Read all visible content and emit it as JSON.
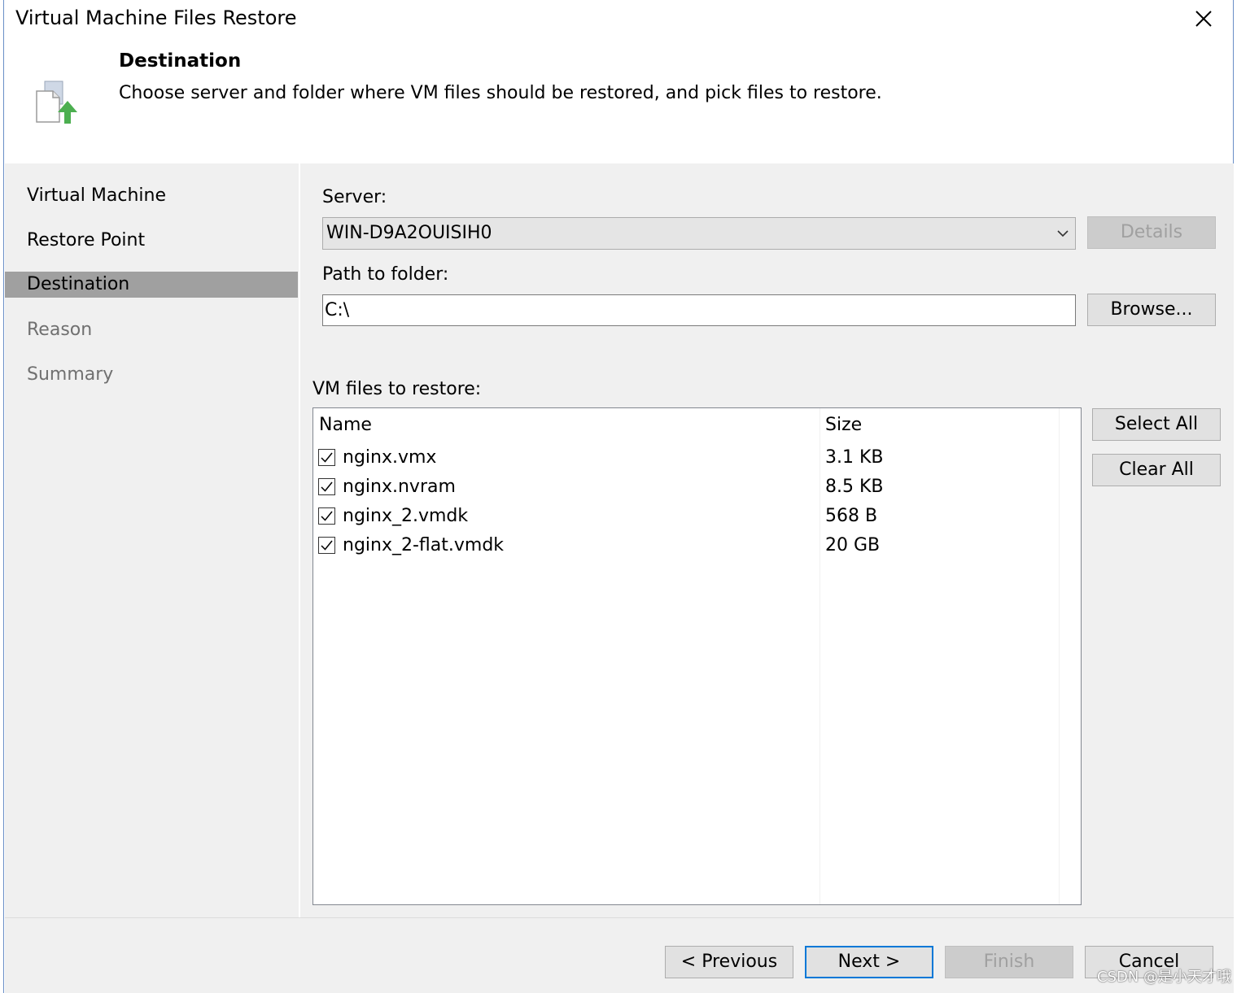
{
  "window": {
    "title": "Virtual Machine Files Restore"
  },
  "header": {
    "heading": "Destination",
    "description": "Choose server and folder where VM files should be restored, and pick files to restore."
  },
  "nav": {
    "items": [
      {
        "label": "Virtual Machine",
        "state": "normal"
      },
      {
        "label": "Restore Point",
        "state": "normal"
      },
      {
        "label": "Destination",
        "state": "active"
      },
      {
        "label": "Reason",
        "state": "disabled"
      },
      {
        "label": "Summary",
        "state": "disabled"
      }
    ]
  },
  "server": {
    "label": "Server:",
    "value": "WIN-D9A2OUISIH0",
    "details_label": "Details"
  },
  "path": {
    "label": "Path to folder:",
    "value": "C:\\",
    "browse_label": "Browse..."
  },
  "files": {
    "label": "VM files to restore:",
    "columns": [
      "Name",
      "Size"
    ],
    "rows": [
      {
        "name": "nginx.vmx",
        "size": "3.1 KB",
        "checked": true
      },
      {
        "name": "nginx.nvram",
        "size": "8.5 KB",
        "checked": true
      },
      {
        "name": "nginx_2.vmdk",
        "size": "568 B",
        "checked": true
      },
      {
        "name": "nginx_2-flat.vmdk",
        "size": "20 GB",
        "checked": true
      }
    ],
    "select_all_label": "Select All",
    "clear_all_label": "Clear All"
  },
  "footer": {
    "previous_label": "< Previous",
    "next_label": "Next >",
    "finish_label": "Finish",
    "cancel_label": "Cancel"
  },
  "watermark": "CSDN @是小天才哦",
  "colors": {
    "accent": "#0078d7",
    "active_nav": "#a0a0a0",
    "panel": "#f0f0f0",
    "icon_arrow": "#4caf50"
  }
}
